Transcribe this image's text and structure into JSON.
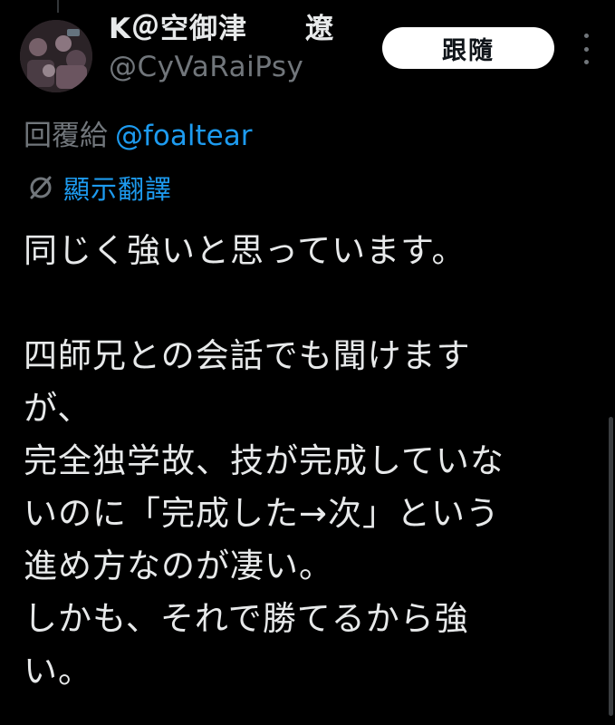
{
  "tweet": {
    "author": {
      "display_name": "K＠空御津　　遼",
      "handle": "@CyVaRaiPsy",
      "avatar_icon": "profile-photo"
    },
    "follow_label": "跟隨",
    "more_icon": "more-vertical-icon",
    "reply_to": {
      "label": "回覆給",
      "mention": "@foaltear"
    },
    "translate": {
      "icon": "translate-globe-icon",
      "label": "顯示翻譯"
    },
    "body": "同じく強いと思っています。\n\n四師兄との会話でも聞けます\nが、\n完全独学故、技が完成していな\nいのに「完成した→次」という\n進め方なのが凄い。\nしかも、それで勝てるから強\nい。"
  },
  "colors": {
    "background": "#000000",
    "text_primary": "#e7e9ea",
    "text_secondary": "#71767b",
    "accent": "#1d9bf0",
    "button_bg": "#ffffff",
    "button_text": "#0f1419"
  }
}
